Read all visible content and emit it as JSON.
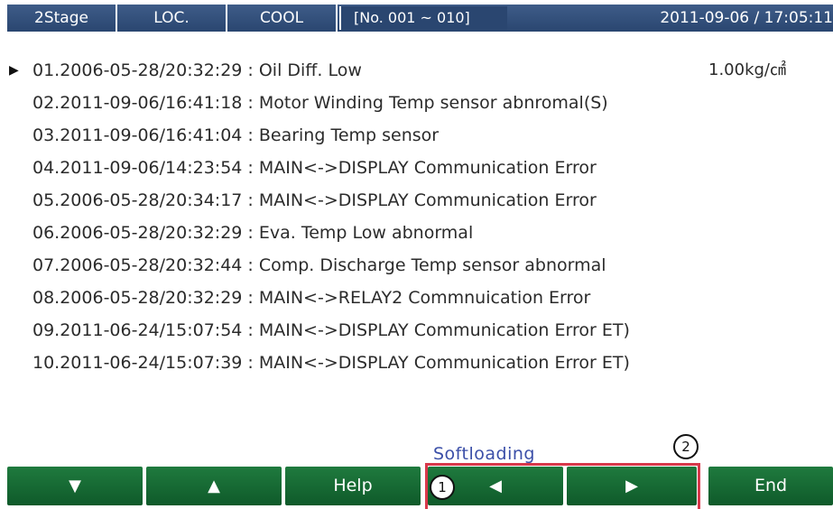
{
  "status_bar": {
    "stage": "2Stage",
    "location": "LOC.",
    "mode": "COOL",
    "range": "[No. 001 ~ 010]",
    "datetime": "2011-09-06 / 17:05:11"
  },
  "alarms": [
    {
      "text": "01.2006-05-28/20:32:29 : Oil Diff. Low",
      "value": "1.00kg/㎠",
      "selected": true
    },
    {
      "text": "02.2011-09-06/16:41:18 : Motor Winding Temp sensor abnromal(S)"
    },
    {
      "text": "03.2011-09-06/16:41:04 : Bearing Temp sensor"
    },
    {
      "text": "04.2011-09-06/14:23:54 : MAIN<->DISPLAY Communication Error"
    },
    {
      "text": "05.2006-05-28/20:34:17 : MAIN<->DISPLAY Communication Error"
    },
    {
      "text": "06.2006-05-28/20:32:29 : Eva. Temp Low abnormal"
    },
    {
      "text": "07.2006-05-28/20:32:44 : Comp. Discharge Temp sensor abnormal"
    },
    {
      "text": "08.2006-05-28/20:32:29 : MAIN<->RELAY2 Commnuication Error"
    },
    {
      "text": "09.2011-06-24/15:07:54 : MAIN<->DISPLAY Communication Error ET)"
    },
    {
      "text": "10.2011-06-24/15:07:39 : MAIN<->DISPLAY Communication Error ET)"
    }
  ],
  "soft_label": "Softloading",
  "keys": {
    "down": "▼",
    "up": "▲",
    "help": "Help",
    "prev": "◀",
    "next": "▶",
    "end": "End"
  },
  "annotations": {
    "badge1": "1",
    "badge2": "2"
  },
  "colors": {
    "status_bar": "#2a4670",
    "key_green": "#0f5a2a",
    "callout_red": "#d8394b",
    "soft_label": "#3b4fa8"
  },
  "icons": {
    "cursor": "triangle-right"
  }
}
